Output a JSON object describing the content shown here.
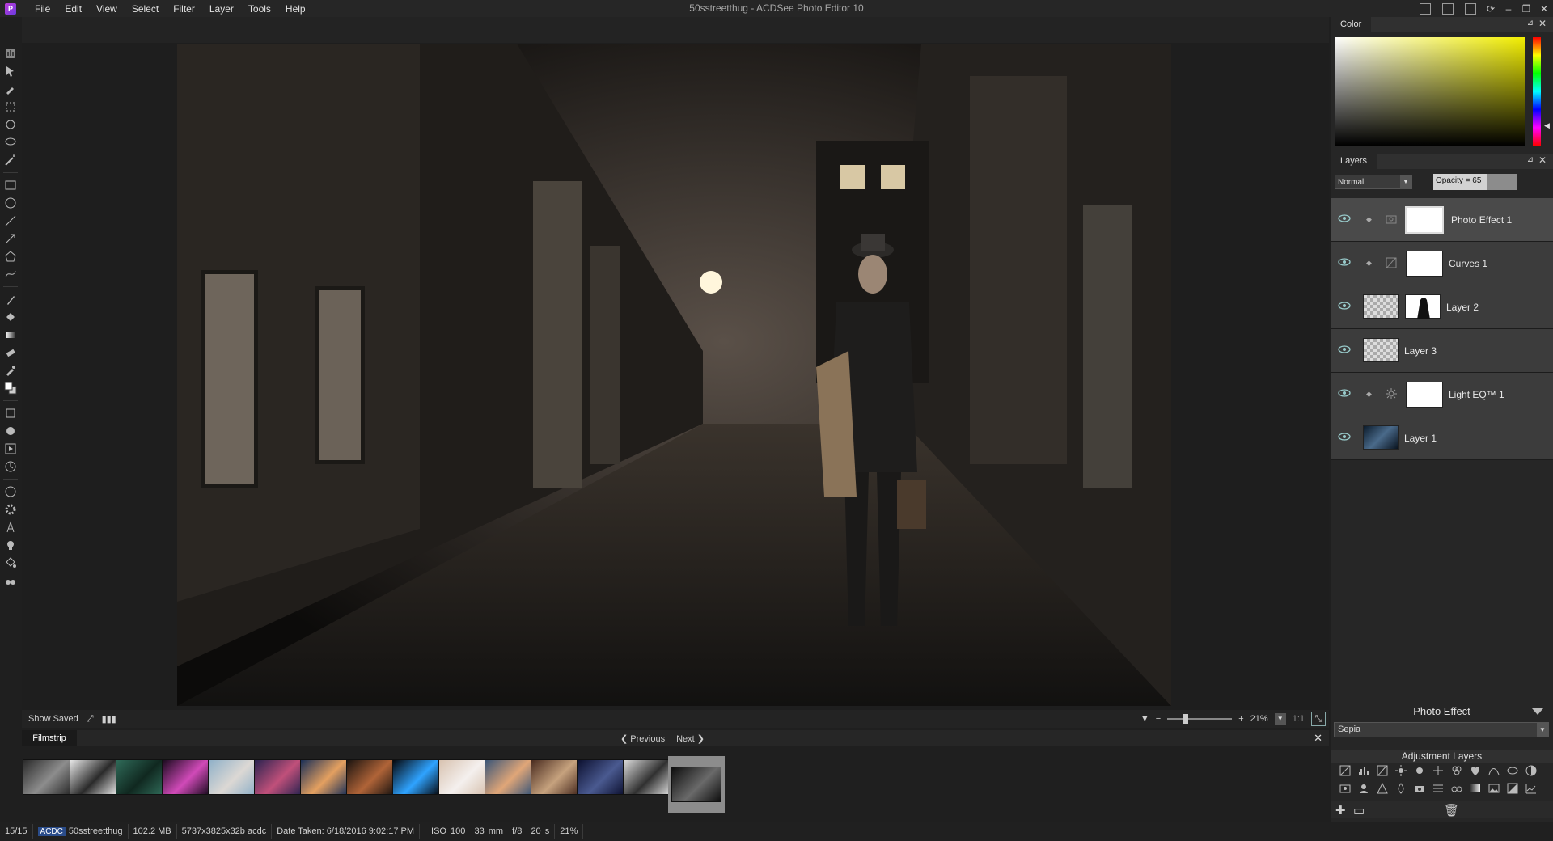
{
  "app": {
    "window_title": "50sstreetthug - ACDSee Photo Editor 10",
    "logo_glyph": "P"
  },
  "menu": [
    "File",
    "Edit",
    "View",
    "Select",
    "Filter",
    "Layer",
    "Tools",
    "Help"
  ],
  "window_controls": {
    "minimize": "–",
    "restore": "❐",
    "close": "✕"
  },
  "canvas": {
    "image_subject": "night alley street scene with man in suit and hat"
  },
  "viewbar": {
    "show_saved": "Show Saved",
    "zoom_percent": "21%",
    "one_to_one": "1:1"
  },
  "filmstrip": {
    "tab": "Filmstrip",
    "previous": "Previous",
    "next": "Next",
    "close": "✕",
    "thumbnail_colors": [
      [
        "#2b2b2b",
        "#8d8d8d"
      ],
      [
        "#e6e6e6",
        "#2a2a2a"
      ],
      [
        "#2f6a58",
        "#102820"
      ],
      [
        "#1a0a1e",
        "#d04ab8"
      ],
      [
        "#8fb0c8",
        "#dcd8d4"
      ],
      [
        "#2a2350",
        "#c0507a"
      ],
      [
        "#1a2f57",
        "#e4a060"
      ],
      [
        "#1b1410",
        "#b06438"
      ],
      [
        "#06070c",
        "#2fa3ff"
      ],
      [
        "#d8c2b0",
        "#f4f0ee"
      ],
      [
        "#3b5678",
        "#e0a678"
      ],
      [
        "#4a2c20",
        "#c6a27e"
      ],
      [
        "#0c1030",
        "#4a5a90"
      ],
      [
        "#dcdcdc",
        "#303030"
      ],
      [
        "#0e0e0e",
        "#6a6a6a"
      ]
    ],
    "selected_index": 14
  },
  "status": {
    "index": "15/15",
    "badge": "ACDC",
    "filename": "50sstreetthug",
    "filesize": "102.2 MB",
    "dimensions": "5737x3825x32b acdc",
    "date_taken": "Date Taken: 6/18/2016 9:02:17 PM",
    "iso": "ISO 100",
    "focal": "33 mm",
    "aperture": "f/8",
    "shutter": "20 s",
    "zoom": "21%"
  },
  "color_panel": {
    "title": "Color",
    "hue_color": "#f2ee00"
  },
  "layers_panel": {
    "title": "Layers",
    "blend_mode": "Normal",
    "opacity_label": "Opacity = 65",
    "opacity_value": 65,
    "layers": [
      {
        "name": "Photo Effect  1",
        "selected": true
      },
      {
        "name": "Curves  1",
        "selected": false
      },
      {
        "name": "Layer 2",
        "selected": false
      },
      {
        "name": "Layer 3",
        "selected": false
      },
      {
        "name": "Light EQ™  1",
        "selected": false
      },
      {
        "name": "Layer 1",
        "selected": false
      }
    ]
  },
  "photo_effect": {
    "label": "Photo Effect",
    "selected": "Sepia"
  },
  "adjustment_layers": {
    "title": "Adjustment Layers"
  }
}
